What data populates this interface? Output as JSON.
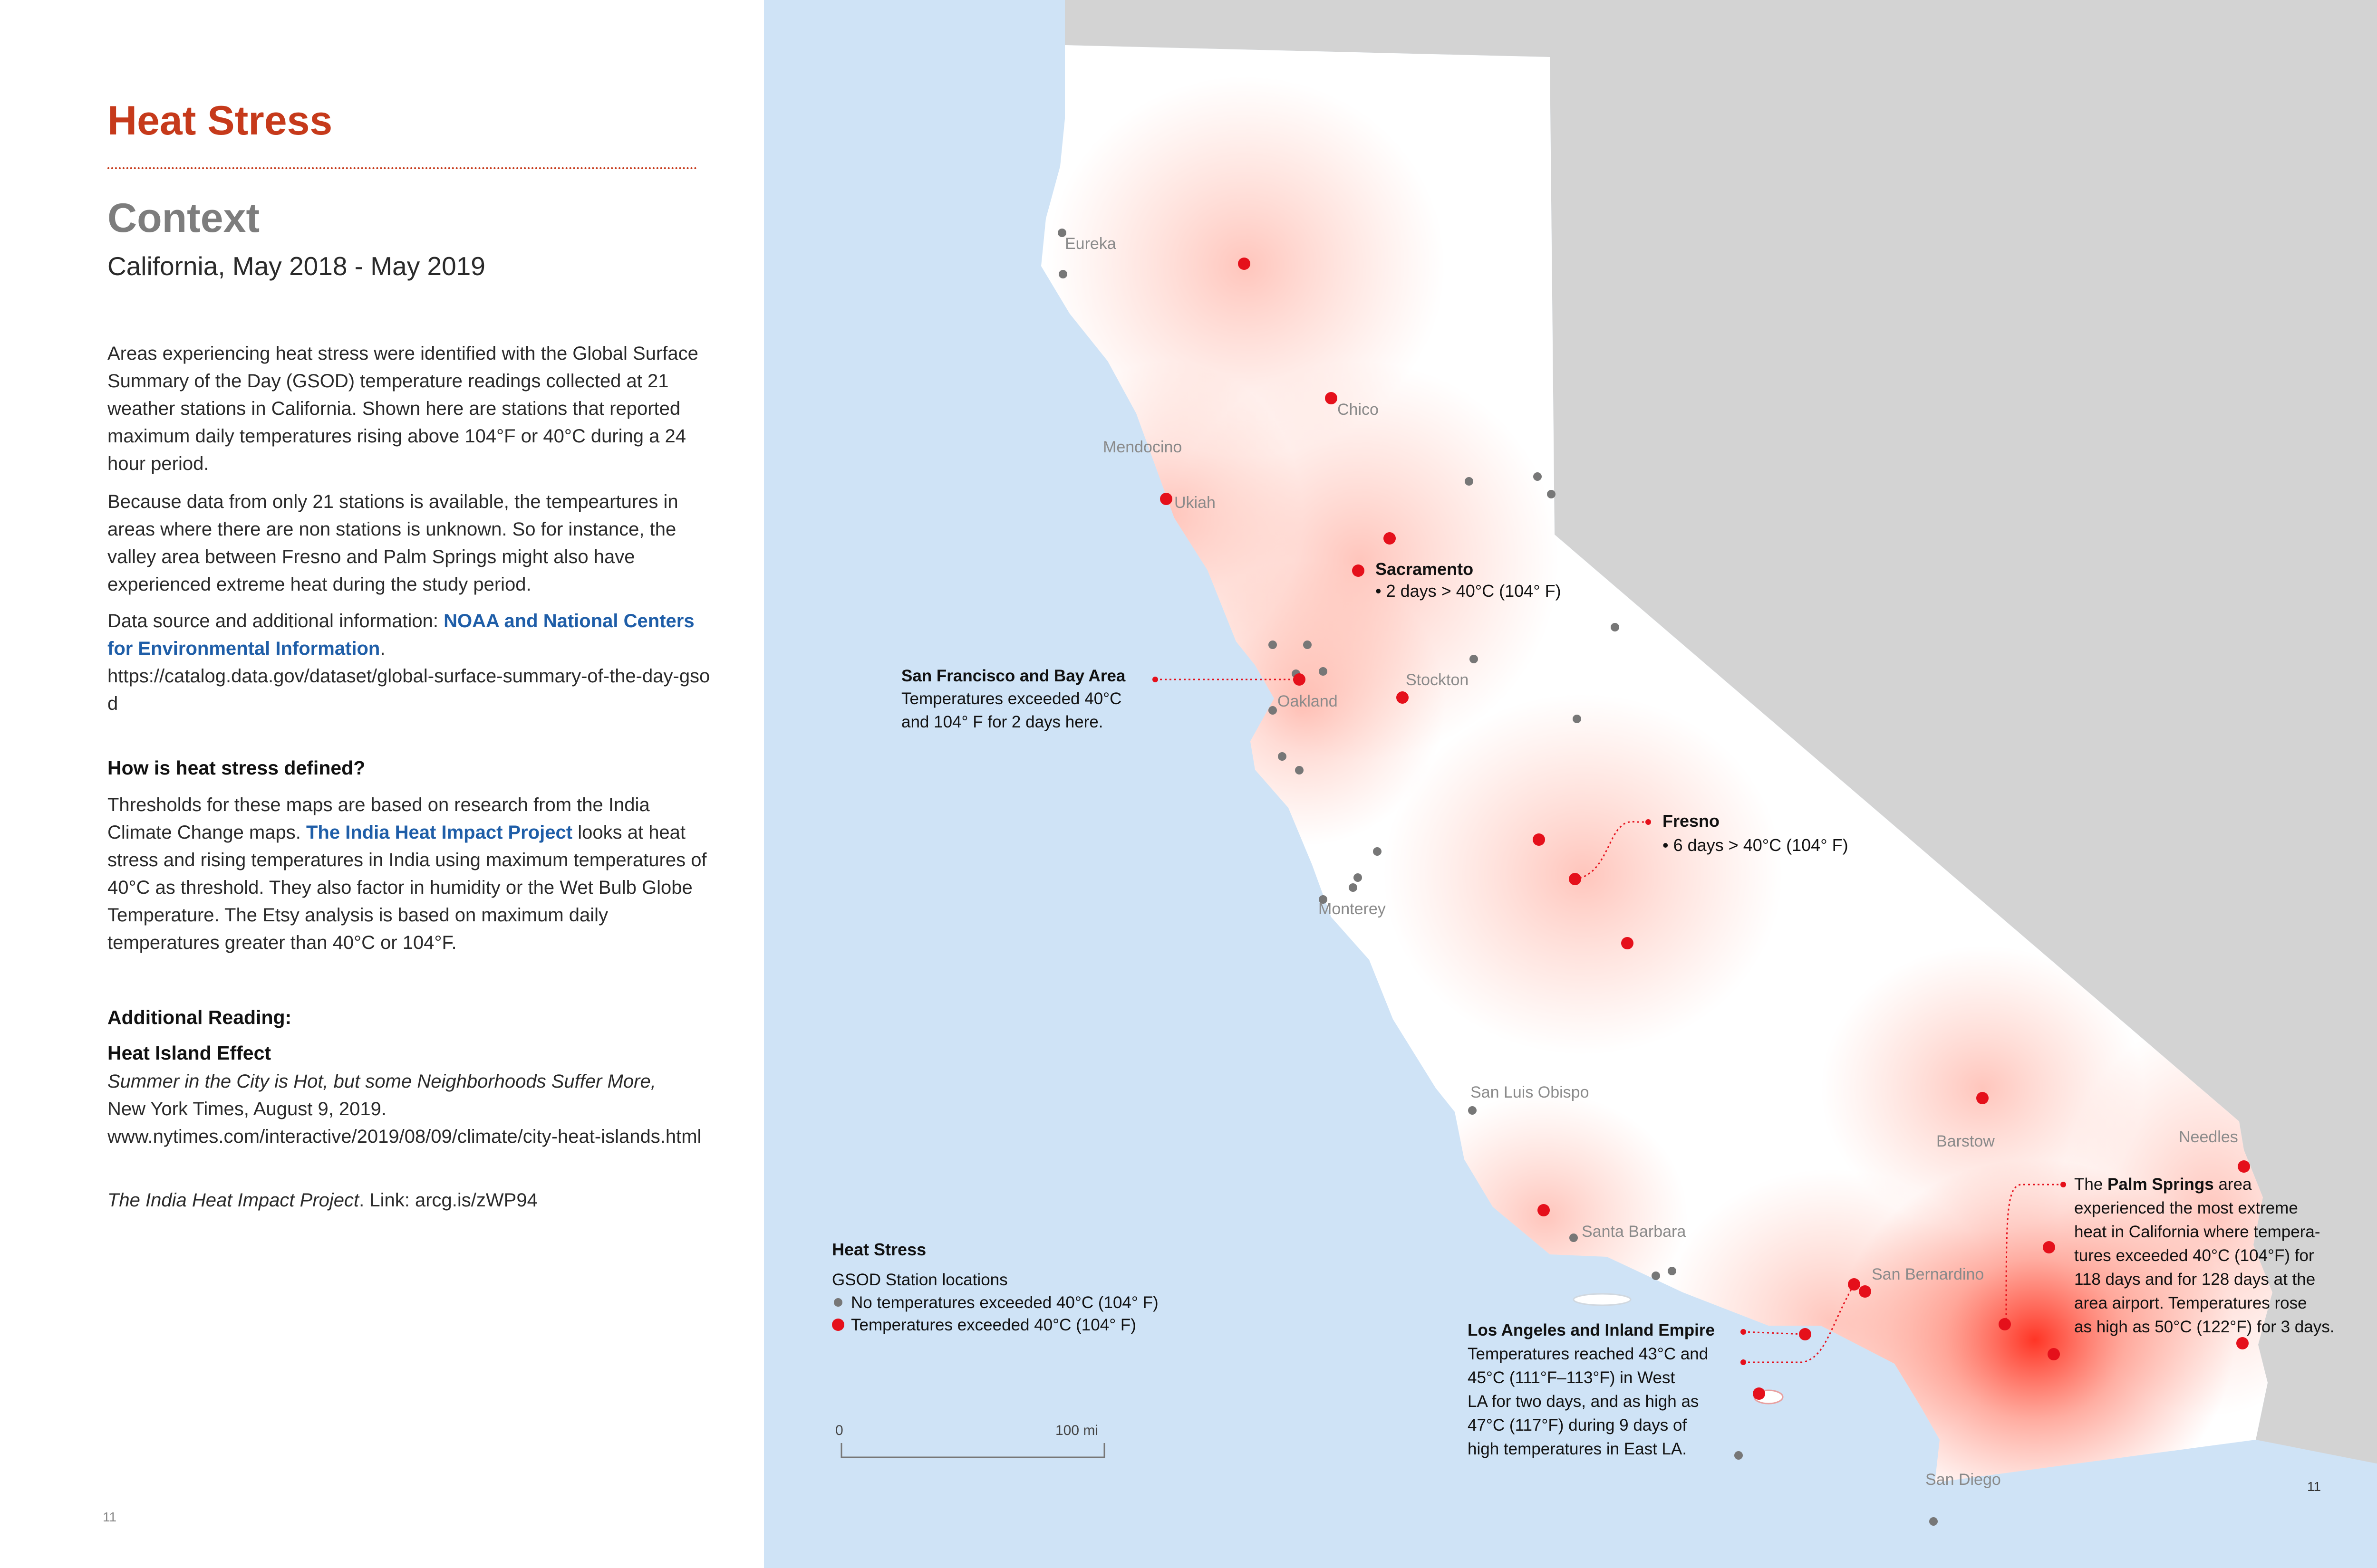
{
  "left": {
    "title": "Heat Stress",
    "context_heading": "Context",
    "subtitle": "California, May 2018 - May 2019",
    "para1": "Areas experiencing heat stress were identified with the Global Surface Summary of the Day (GSOD) temperature readings collected at 21 weather stations in California. Shown here are stations that reported maximum daily temperatures rising above 104°F or 40°C during a 24 hour period.",
    "para2": "Because data from only 21 stations is available, the tempeartures in areas where there are non stations is unknown. So for instance, the valley area between Fresno and Palm Springs might also have experienced extreme heat during the study period.",
    "source_prefix": "Data source and additional information: ",
    "source_link": "NOAA and National Centers for Environmental Information",
    "source_url": "https://catalog.data.gov/dataset/global-surface-summary-of-the-day-gsod",
    "heading2": "How is heat stress defined?",
    "def_part1": "Thresholds for these maps are based on research from the India Climate Change maps. ",
    "def_link": "The India Heat Impact Project",
    "def_part2": " looks at heat stress and rising temperatures in India using maximum temperatures of 40°C as threshold. They also factor in humidity or the Wet Bulb Globe Temperature. The Etsy analysis is based on maximum daily temperatures greater than 40°C or 104°F.",
    "heading3": "Additional Reading:",
    "reading_title": "Heat Island Effect",
    "reading_article": "Summer in the City is Hot, but some Neighborhoods Suffer More,",
    "reading_source": "New York Times, August 9, 2019.",
    "reading_url": "www.nytimes.com/interactive/2019/08/09/climate/city-heat-islands.html",
    "india_title": "The India Heat Impact Project",
    "india_link": ". Link: arcg.is/zWP94",
    "page_left": "11"
  },
  "map": {
    "cities": {
      "eureka": "Eureka",
      "chico": "Chico",
      "mendocino": "Mendocino",
      "ukiah": "Ukiah",
      "stockton": "Stockton",
      "oakland": "Oakland",
      "monterey": "Monterey",
      "san_luis_obispo": "San Luis Obispo",
      "santa_barbara": "Santa Barbara",
      "barstow": "Barstow",
      "needles": "Needles",
      "san_bernardino": "San Bernardino",
      "san_diego": "San Diego"
    },
    "sacramento": {
      "name": "Sacramento",
      "detail": "• 2 days > 40°C (104° F)"
    },
    "fresno": {
      "name": "Fresno",
      "detail": "• 6 days > 40°C (104° F)"
    },
    "sf": {
      "name": "San Francisco and Bay Area",
      "line1": "Temperatures exceeded 40°C",
      "line2": "and 104° F for 2 days here."
    },
    "la": {
      "name": "Los Angeles and Inland Empire",
      "line1": "Temperatures reached 43°C and",
      "line2": "45°C (111°F–113°F) in West",
      "line3": "LA for two days, and as high as",
      "line4": "47°C  (117°F) during 9 days of",
      "line5": "high temperatures  in East LA."
    },
    "palm": {
      "line1_pre": "The ",
      "line1_bold": "Palm Springs",
      "line1_post": " area",
      "line2": "experienced the most extreme",
      "line3": "heat in California where tempera-",
      "line4": "tures exceeded 40°C (104°F) for",
      "line5": "118 days and for 128 days at the",
      "line6": "area airport. Temperatures rose",
      "line7": "as high as 50°C (122°F) for 3 days."
    },
    "legend": {
      "title": "Heat Stress",
      "subtitle": "GSOD Station locations",
      "item1": "No temperatures exceeded 40°C (104° F)",
      "item2": "Temperatures exceeded 40°C (104° F)",
      "item1_color": "#777777",
      "item2_color": "#e5101b"
    },
    "scale": {
      "start": "0",
      "end": "100 mi"
    },
    "page_right": "11",
    "colors": {
      "ocean": "#cfe3f6",
      "land_outside": "#d3d3d3",
      "california": "#ffffff",
      "heat": "#ff2a1a",
      "station_hot": "#e5101b",
      "station_normal": "#777777"
    }
  }
}
